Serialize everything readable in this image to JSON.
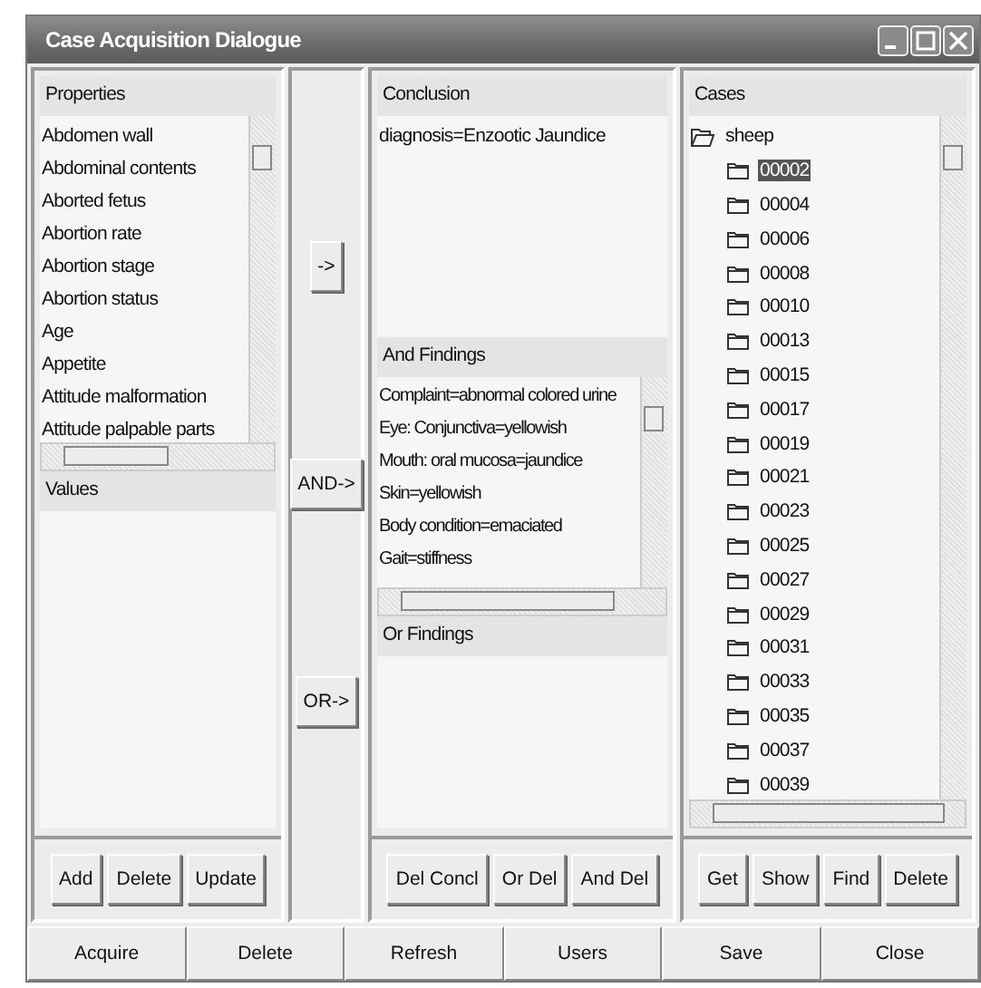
{
  "window": {
    "title": "Case Acquisition Dialogue"
  },
  "properties": {
    "title": "Properties",
    "items": [
      "Abdomen wall",
      "Abdominal contents",
      "Aborted fetus",
      "Abortion rate",
      "Abortion stage",
      "Abortion status",
      "Age",
      "Appetite",
      "Attitude malformation",
      "Attitude palpable parts"
    ]
  },
  "values": {
    "title": "Values"
  },
  "properties_buttons": [
    "Add",
    "Delete",
    "Update"
  ],
  "transfer_buttons": [
    "->",
    "AND->",
    "OR->"
  ],
  "conclusion": {
    "title": "Conclusion",
    "items": [
      "diagnosis=Enzootic Jaundice"
    ]
  },
  "and_findings": {
    "title": "And Findings",
    "items": [
      "Complaint=abnormal colored urine",
      "Eye: Conjunctiva=yellowish",
      "Mouth: oral mucosa=jaundice",
      "Skin=yellowish",
      "Body condition=emaciated",
      "Gait=stiffness"
    ]
  },
  "or_findings": {
    "title": "Or Findings"
  },
  "conclusion_buttons": [
    "Del Concl",
    "Or Del",
    "And Del"
  ],
  "cases": {
    "title": "Cases",
    "tree": {
      "label": "sheep",
      "expanded": true,
      "children": [
        {
          "label": "00002",
          "selected": true
        },
        {
          "label": "00004",
          "selected": false
        },
        {
          "label": "00006",
          "selected": false
        },
        {
          "label": "00008",
          "selected": false
        },
        {
          "label": "00010",
          "selected": false
        },
        {
          "label": "00013",
          "selected": false
        },
        {
          "label": "00015",
          "selected": false
        },
        {
          "label": "00017",
          "selected": false
        },
        {
          "label": "00019",
          "selected": false
        },
        {
          "label": "00021",
          "selected": false
        },
        {
          "label": "00023",
          "selected": false
        },
        {
          "label": "00025",
          "selected": false
        },
        {
          "label": "00027",
          "selected": false
        },
        {
          "label": "00029",
          "selected": false
        },
        {
          "label": "00031",
          "selected": false
        },
        {
          "label": "00033",
          "selected": false
        },
        {
          "label": "00035",
          "selected": false
        },
        {
          "label": "00037",
          "selected": false
        },
        {
          "label": "00039",
          "selected": false
        }
      ]
    }
  },
  "cases_buttons": [
    "Get",
    "Show",
    "Find",
    "Delete"
  ],
  "bottom_buttons": [
    "Acquire",
    "Delete",
    "Refresh",
    "Users",
    "Save",
    "Close"
  ]
}
